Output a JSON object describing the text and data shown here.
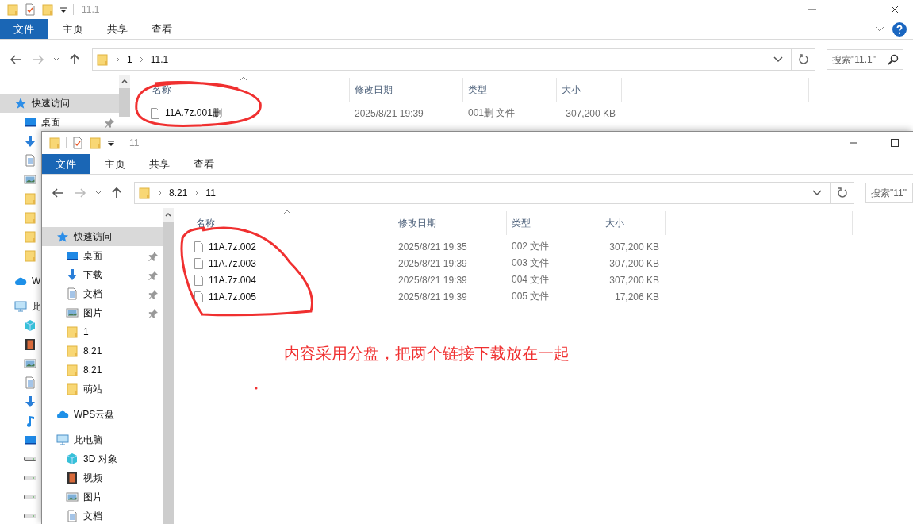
{
  "back_window": {
    "title": "11.1",
    "ribbon_tabs": [
      {
        "label": "文件",
        "kind": "file"
      },
      {
        "label": "主页",
        "kind": "tab"
      },
      {
        "label": "共享",
        "kind": "tab"
      },
      {
        "label": "查看",
        "kind": "tab"
      }
    ],
    "address": [
      "1",
      "11.1"
    ],
    "search": {
      "placeholder": "搜索\"11.1\""
    },
    "sidebar": [
      {
        "label": "快速访问",
        "kind": "quick",
        "selected": true,
        "children": [
          {
            "label": "桌面",
            "kind": "desktop",
            "pinned": true
          },
          {
            "kind": "download",
            "pinned": false
          },
          {
            "kind": "document",
            "pinned": false
          },
          {
            "kind": "picture",
            "pinned": false
          },
          {
            "kind": "folder",
            "pinned": false
          },
          {
            "kind": "folder",
            "pinned": false
          },
          {
            "kind": "folder",
            "pinned": false
          },
          {
            "kind": "folder",
            "pinned": false
          }
        ]
      },
      {
        "label": "W",
        "kind": "cloud",
        "selected": false
      },
      {
        "label": "此",
        "kind": "pc",
        "selected": false,
        "children": [
          {
            "kind": "cube"
          },
          {
            "kind": "video"
          },
          {
            "kind": "picture"
          },
          {
            "kind": "document"
          },
          {
            "kind": "download"
          },
          {
            "kind": "music"
          },
          {
            "kind": "desktop"
          },
          {
            "kind": "drive"
          },
          {
            "kind": "drive"
          },
          {
            "kind": "drive"
          },
          {
            "kind": "drive"
          }
        ]
      }
    ],
    "columns": [
      "名称",
      "修改日期",
      "类型",
      "大小"
    ],
    "files": [
      {
        "name": "11A.7z.001删",
        "modified": "2025/8/21 19:39",
        "type": "001删 文件",
        "size": "307,200 KB"
      }
    ]
  },
  "front_window": {
    "title": "11",
    "ribbon_tabs": [
      {
        "label": "文件",
        "kind": "file"
      },
      {
        "label": "主页",
        "kind": "tab"
      },
      {
        "label": "共享",
        "kind": "tab"
      },
      {
        "label": "查看",
        "kind": "tab"
      }
    ],
    "address": [
      "8.21",
      "11"
    ],
    "search": {
      "placeholder": "搜索\"11\""
    },
    "sidebar": [
      {
        "label": "快速访问",
        "kind": "quick",
        "selected": true,
        "children": [
          {
            "label": "桌面",
            "kind": "desktop",
            "pinned": true
          },
          {
            "label": "下载",
            "kind": "download",
            "pinned": true
          },
          {
            "label": "文档",
            "kind": "document",
            "pinned": true
          },
          {
            "label": "图片",
            "kind": "picture",
            "pinned": true
          },
          {
            "label": "1",
            "kind": "folder",
            "pinned": false
          },
          {
            "label": "8.21",
            "kind": "folder",
            "pinned": false
          },
          {
            "label": "8.21",
            "kind": "folder",
            "pinned": false
          },
          {
            "label": "萌站",
            "kind": "folder",
            "pinned": false
          }
        ]
      },
      {
        "label": "WPS云盘",
        "kind": "cloud",
        "selected": false
      },
      {
        "label": "此电脑",
        "kind": "pc",
        "selected": false,
        "children": [
          {
            "label": "3D 对象",
            "kind": "cube"
          },
          {
            "label": "视频",
            "kind": "video"
          },
          {
            "label": "图片",
            "kind": "picture"
          },
          {
            "label": "文档",
            "kind": "document"
          }
        ]
      }
    ],
    "columns": [
      "名称",
      "修改日期",
      "类型",
      "大小"
    ],
    "files": [
      {
        "name": "11A.7z.002",
        "modified": "2025/8/21 19:35",
        "type": "002 文件",
        "size": "307,200 KB"
      },
      {
        "name": "11A.7z.003",
        "modified": "2025/8/21 19:39",
        "type": "003 文件",
        "size": "307,200 KB"
      },
      {
        "name": "11A.7z.004",
        "modified": "2025/8/21 19:39",
        "type": "004 文件",
        "size": "307,200 KB"
      },
      {
        "name": "11A.7z.005",
        "modified": "2025/8/21 19:39",
        "type": "005 文件",
        "size": "17,206 KB"
      }
    ]
  },
  "annotation": {
    "note": "内容采用分盘，把两个链接下载放在一起"
  }
}
